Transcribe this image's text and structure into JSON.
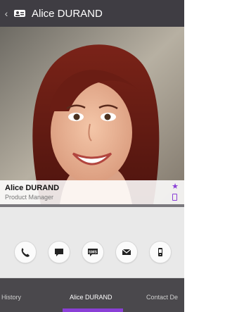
{
  "header": {
    "title": "Alice DURAND",
    "back_icon": "chevron-left-icon",
    "app_icon": "contact-card-icon"
  },
  "contact": {
    "name": "Alice DURAND",
    "role": "Product Manager",
    "favorite_icon": "star-icon",
    "device_icon": "mobile-icon"
  },
  "actions": [
    {
      "name": "call",
      "icon": "phone-icon"
    },
    {
      "name": "message",
      "icon": "chat-bubble-icon"
    },
    {
      "name": "sms",
      "icon": "sms-icon",
      "label": "SMS"
    },
    {
      "name": "email",
      "icon": "envelope-icon"
    },
    {
      "name": "mobile",
      "icon": "mobile-icon"
    }
  ],
  "tabs": {
    "history": "History",
    "main": "Alice DURAND",
    "details": "Contact De",
    "active": "main"
  },
  "colors": {
    "accent": "#8a3fd6",
    "appbar": "#3f3d43",
    "tabbar": "#4a484c",
    "actions_bg": "#e9e9e9"
  }
}
